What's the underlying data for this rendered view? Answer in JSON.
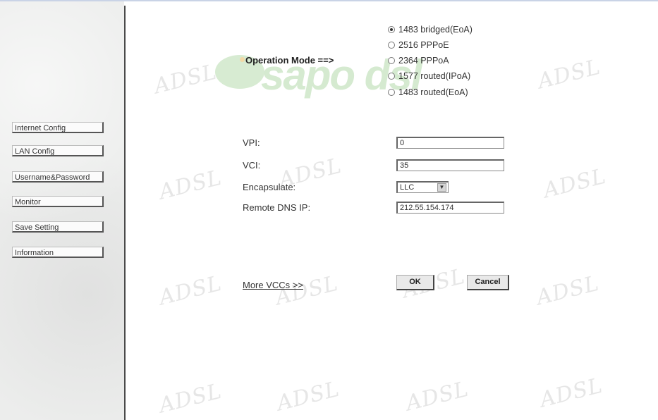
{
  "sidebar": {
    "items": [
      {
        "label": "Internet Config"
      },
      {
        "label": "LAN Config"
      },
      {
        "label": "Username&Password"
      },
      {
        "label": "Monitor"
      },
      {
        "label": "Save Setting"
      },
      {
        "label": "Information"
      }
    ]
  },
  "watermark": {
    "text": "ADSL"
  },
  "logo": {
    "text": "sapo dsl"
  },
  "operation_mode": {
    "label": "Operation Mode ==>",
    "options": [
      {
        "label": "1483 bridged(EoA)",
        "checked": true
      },
      {
        "label": "2516 PPPoE",
        "checked": false
      },
      {
        "label": "2364 PPPoA",
        "checked": false
      },
      {
        "label": "1577 routed(IPoA)",
        "checked": false
      },
      {
        "label": "1483 routed(EoA)",
        "checked": false
      }
    ]
  },
  "form": {
    "vpi_label": "VPI:",
    "vpi_value": "0",
    "vci_label": "VCI:",
    "vci_value": "35",
    "encapsulate_label": "Encapsulate:",
    "encapsulate_value": "LLC",
    "remote_dns_label": "Remote DNS IP:",
    "remote_dns_value": "212.55.154.174"
  },
  "actions": {
    "more_vccs": "More VCCs >>",
    "ok": "OK",
    "cancel": "Cancel"
  }
}
